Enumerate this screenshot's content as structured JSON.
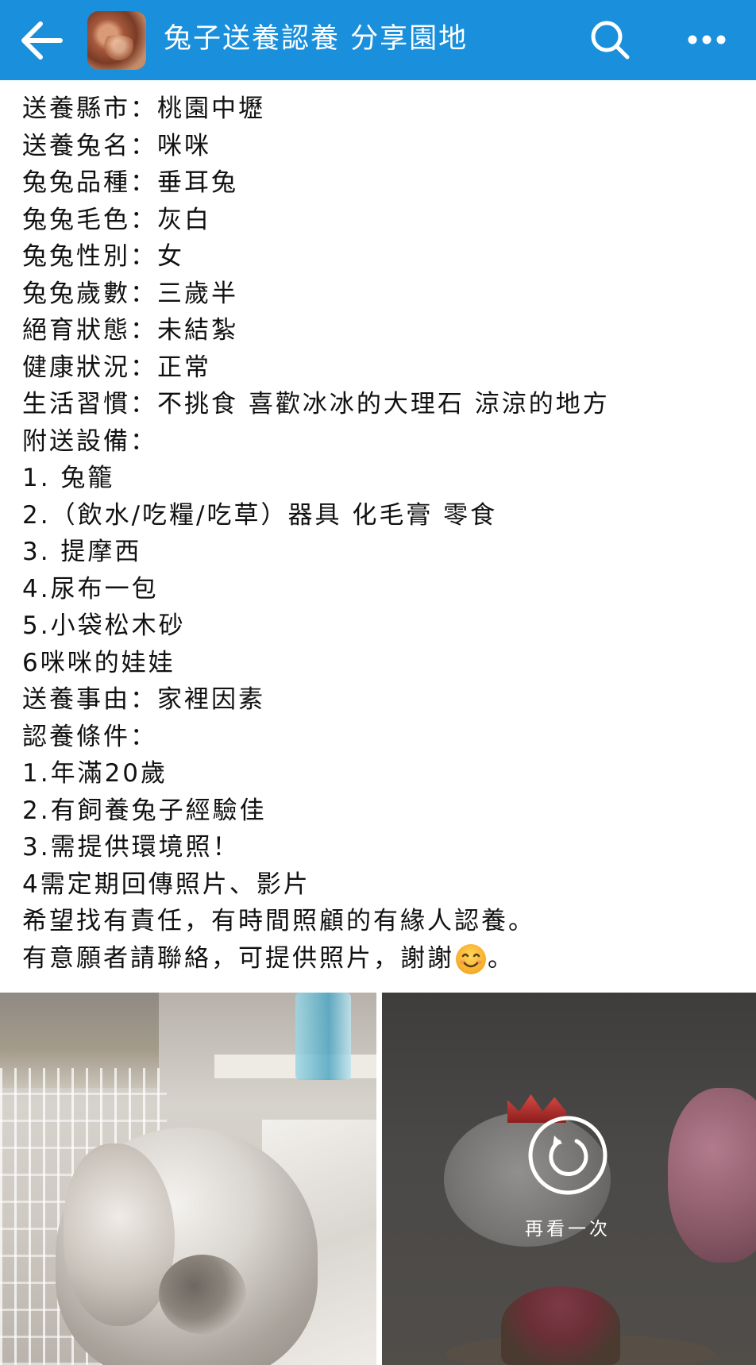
{
  "header": {
    "title": "兔子送養認養 分享園地",
    "back_icon": "arrow-left-icon",
    "search_icon": "search-icon",
    "more_icon": "more-horizontal-icon",
    "background_color": "#1a8fdc"
  },
  "post": {
    "lines": [
      "送養縣市：桃園中壢",
      "送養兔名：咪咪",
      "兔兔品種：垂耳兔",
      "兔兔毛色：灰白",
      "兔兔性別：女",
      "兔兔歲數：三歲半",
      "絕育狀態：未結紮",
      "健康狀況：正常",
      "生活習慣：不挑食 喜歡冰冰的大理石 涼涼的地方",
      "附送設備：",
      "1. 兔籠",
      "2.（飲水/吃糧/吃草）器具 化毛膏 零食",
      "3. 提摩西",
      "4.尿布一包",
      "5.小袋松木砂",
      "6咪咪的娃娃",
      "送養事由：家裡因素",
      "認養條件：",
      "1.年滿20歲",
      "2.有飼養兔子經驗佳",
      "3.需提供環境照！",
      "4需定期回傳照片、影片",
      "希望找有責任，有時間照顧的有緣人認養。",
      "有意願者請聯絡，可提供照片，謝謝"
    ],
    "last_line_suffix": "。",
    "emoji_icon": "smiling-face-icon"
  },
  "media": {
    "replay_label": "再看一次",
    "replay_icon": "replay-icon"
  }
}
